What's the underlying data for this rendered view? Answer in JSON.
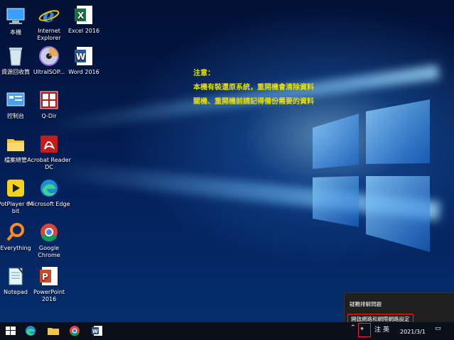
{
  "desktop_icons": [
    {
      "label": "本機"
    },
    {
      "label": "Internet Explorer"
    },
    {
      "label": "Excel 2016"
    },
    {
      "label": "資源回收筒"
    },
    {
      "label": "UltraISOP..."
    },
    {
      "label": "Word 2016"
    },
    {
      "label": "控制台"
    },
    {
      "label": "Q-Dir"
    },
    {
      "label": "檔案總管"
    },
    {
      "label": "Acrobat Reader DC"
    },
    {
      "label": "PotPlayer 64 bit"
    },
    {
      "label": "Microsoft Edge"
    },
    {
      "label": "Everything"
    },
    {
      "label": "Google Chrome"
    },
    {
      "label": "Notepad"
    },
    {
      "label": "PowerPoint 2016"
    }
  ],
  "notice": {
    "line1": "注意：",
    "line2": "本機有裝還原系統，重開機會清除資料",
    "line3": "關機、重開機前請記得備份需要的資料"
  },
  "network_menu": {
    "item1": "疑難排解問題",
    "item2": "開啟網路和網際網路設定"
  },
  "tray": {
    "ime": "注",
    "lang": "英",
    "date": "2021/3/1"
  },
  "colors": {
    "notice_text": "#e8e000",
    "highlight_border": "#e02b2b"
  }
}
